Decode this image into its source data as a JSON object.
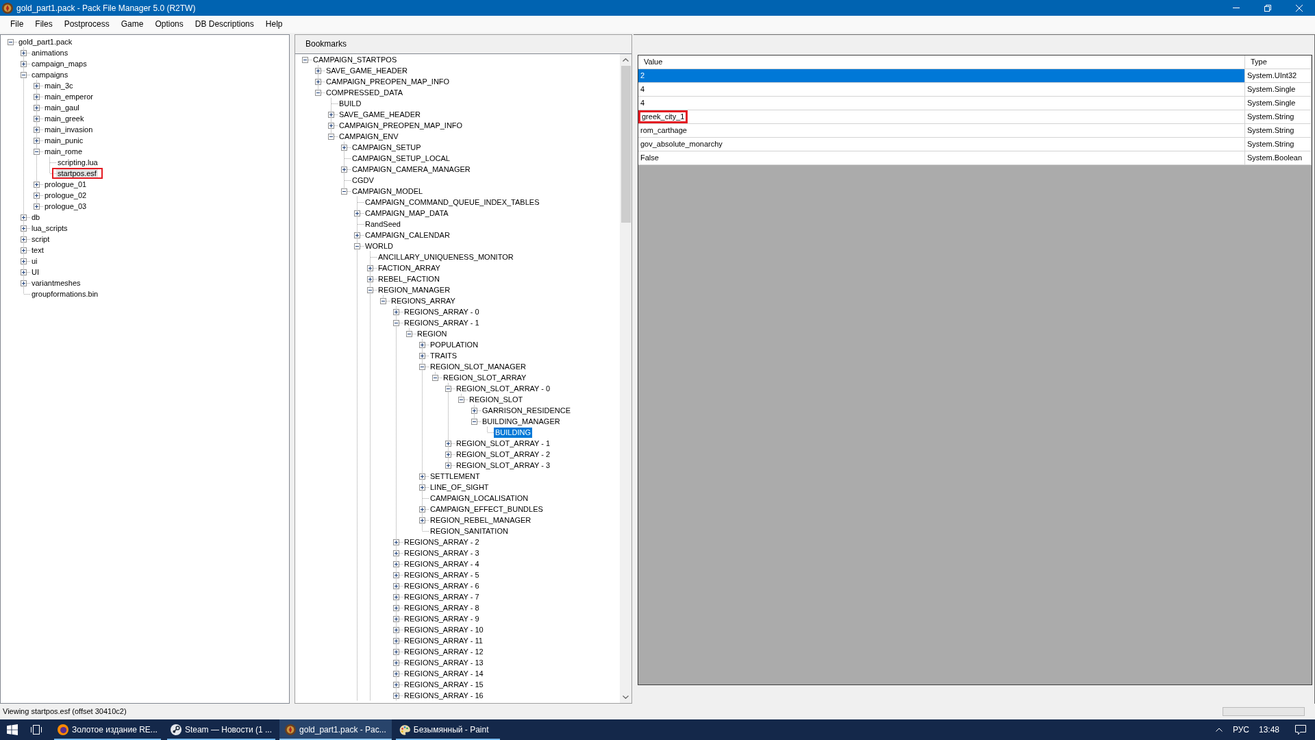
{
  "window": {
    "title": "gold_part1.pack - Pack File Manager 5.0 (R2TW)"
  },
  "menu": [
    "File",
    "Files",
    "Postprocess",
    "Game",
    "Options",
    "DB Descriptions",
    "Help"
  ],
  "file_tree": {
    "focused": false,
    "nodes": [
      {
        "label": "gold_part1.pack",
        "expanded": true,
        "selected": false,
        "annotated": false,
        "children": [
          {
            "label": "animations",
            "expanded": false,
            "selected": false,
            "annotated": false
          },
          {
            "label": "campaign_maps",
            "expanded": false,
            "selected": false,
            "annotated": false
          },
          {
            "label": "campaigns",
            "expanded": true,
            "selected": false,
            "annotated": false,
            "children": [
              {
                "label": "main_3c",
                "expanded": false,
                "selected": false,
                "annotated": false
              },
              {
                "label": "main_emperor",
                "expanded": false,
                "selected": false,
                "annotated": false
              },
              {
                "label": "main_gaul",
                "expanded": false,
                "selected": false,
                "annotated": false
              },
              {
                "label": "main_greek",
                "expanded": false,
                "selected": false,
                "annotated": false
              },
              {
                "label": "main_invasion",
                "expanded": false,
                "selected": false,
                "annotated": false
              },
              {
                "label": "main_punic",
                "expanded": false,
                "selected": false,
                "annotated": false
              },
              {
                "label": "main_rome",
                "expanded": true,
                "selected": false,
                "annotated": false,
                "children": [
                  {
                    "label": "scripting.lua",
                    "selected": false,
                    "annotated": false
                  },
                  {
                    "label": "startpos.esf",
                    "selected": true,
                    "annotated": true
                  }
                ]
              },
              {
                "label": "prologue_01",
                "expanded": false,
                "selected": false,
                "annotated": false
              },
              {
                "label": "prologue_02",
                "expanded": false,
                "selected": false,
                "annotated": false
              },
              {
                "label": "prologue_03",
                "expanded": false,
                "selected": false,
                "annotated": false
              }
            ]
          },
          {
            "label": "db",
            "expanded": false,
            "selected": false,
            "annotated": false
          },
          {
            "label": "lua_scripts",
            "expanded": false,
            "selected": false,
            "annotated": false
          },
          {
            "label": "script",
            "expanded": false,
            "selected": false,
            "annotated": false
          },
          {
            "label": "text",
            "expanded": false,
            "selected": false,
            "annotated": false
          },
          {
            "label": "ui",
            "expanded": false,
            "selected": false,
            "annotated": false
          },
          {
            "label": "UI",
            "expanded": false,
            "selected": false,
            "annotated": false
          },
          {
            "label": "variantmeshes",
            "expanded": false,
            "selected": false,
            "annotated": false
          },
          {
            "label": "groupformations.bin",
            "selected": false,
            "annotated": false
          }
        ]
      }
    ]
  },
  "esf_panel": {
    "toolbar_button": "Bookmarks",
    "tree": {
      "focused": true,
      "nodes": [
        {
          "label": "CAMPAIGN_STARTPOS",
          "expanded": true,
          "selected": false,
          "children": [
            {
              "label": "SAVE_GAME_HEADER",
              "expanded": false,
              "selected": false
            },
            {
              "label": "CAMPAIGN_PREOPEN_MAP_INFO",
              "expanded": false,
              "selected": false
            },
            {
              "label": "COMPRESSED_DATA",
              "expanded": true,
              "selected": false,
              "children": [
                {
                  "label": "BUILD",
                  "selected": false
                },
                {
                  "label": "SAVE_GAME_HEADER",
                  "expanded": false,
                  "selected": false
                },
                {
                  "label": "CAMPAIGN_PREOPEN_MAP_INFO",
                  "expanded": false,
                  "selected": false
                },
                {
                  "label": "CAMPAIGN_ENV",
                  "expanded": true,
                  "selected": false,
                  "children": [
                    {
                      "label": "CAMPAIGN_SETUP",
                      "expanded": false,
                      "selected": false
                    },
                    {
                      "label": "CAMPAIGN_SETUP_LOCAL",
                      "selected": false
                    },
                    {
                      "label": "CAMPAIGN_CAMERA_MANAGER",
                      "expanded": false,
                      "selected": false
                    },
                    {
                      "label": "CGDV",
                      "selected": false
                    },
                    {
                      "label": "CAMPAIGN_MODEL",
                      "expanded": true,
                      "selected": false,
                      "more_below": true,
                      "children": [
                        {
                          "label": "CAMPAIGN_COMMAND_QUEUE_INDEX_TABLES",
                          "selected": false
                        },
                        {
                          "label": "CAMPAIGN_MAP_DATA",
                          "expanded": false,
                          "selected": false
                        },
                        {
                          "label": "RandSeed",
                          "selected": false
                        },
                        {
                          "label": "CAMPAIGN_CALENDAR",
                          "expanded": false,
                          "selected": false
                        },
                        {
                          "label": "WORLD",
                          "expanded": true,
                          "selected": false,
                          "more_below": true,
                          "children": [
                            {
                              "label": "ANCILLARY_UNIQUENESS_MONITOR",
                              "selected": false
                            },
                            {
                              "label": "FACTION_ARRAY",
                              "expanded": false,
                              "selected": false
                            },
                            {
                              "label": "REBEL_FACTION",
                              "expanded": false,
                              "selected": false
                            },
                            {
                              "label": "REGION_MANAGER",
                              "expanded": true,
                              "selected": false,
                              "children": [
                                {
                                  "label": "REGIONS_ARRAY",
                                  "expanded": true,
                                  "selected": false,
                                  "more_below": true,
                                  "children": [
                                    {
                                      "label": "REGIONS_ARRAY - 0",
                                      "expanded": false,
                                      "selected": false
                                    },
                                    {
                                      "label": "REGIONS_ARRAY - 1",
                                      "expanded": true,
                                      "selected": false,
                                      "children": [
                                        {
                                          "label": "REGION",
                                          "expanded": true,
                                          "selected": false,
                                          "children": [
                                            {
                                              "label": "POPULATION",
                                              "expanded": false,
                                              "selected": false
                                            },
                                            {
                                              "label": "TRAITS",
                                              "expanded": false,
                                              "selected": false
                                            },
                                            {
                                              "label": "REGION_SLOT_MANAGER",
                                              "expanded": true,
                                              "selected": false,
                                              "children": [
                                                {
                                                  "label": "REGION_SLOT_ARRAY",
                                                  "expanded": true,
                                                  "selected": false,
                                                  "children": [
                                                    {
                                                      "label": "REGION_SLOT_ARRAY - 0",
                                                      "expanded": true,
                                                      "selected": false,
                                                      "children": [
                                                        {
                                                          "label": "REGION_SLOT",
                                                          "expanded": true,
                                                          "selected": false,
                                                          "children": [
                                                            {
                                                              "label": "GARRISON_RESIDENCE",
                                                              "expanded": false,
                                                              "selected": false
                                                            },
                                                            {
                                                              "label": "BUILDING_MANAGER",
                                                              "expanded": true,
                                                              "selected": false,
                                                              "children": [
                                                                {
                                                                  "label": "BUILDING",
                                                                  "selected": true
                                                                }
                                                              ]
                                                            }
                                                          ]
                                                        }
                                                      ]
                                                    },
                                                    {
                                                      "label": "REGION_SLOT_ARRAY - 1",
                                                      "expanded": false,
                                                      "selected": false
                                                    },
                                                    {
                                                      "label": "REGION_SLOT_ARRAY - 2",
                                                      "expanded": false,
                                                      "selected": false
                                                    },
                                                    {
                                                      "label": "REGION_SLOT_ARRAY - 3",
                                                      "expanded": false,
                                                      "selected": false
                                                    }
                                                  ]
                                                }
                                              ]
                                            },
                                            {
                                              "label": "SETTLEMENT",
                                              "expanded": false,
                                              "selected": false
                                            },
                                            {
                                              "label": "LINE_OF_SIGHT",
                                              "expanded": false,
                                              "selected": false
                                            },
                                            {
                                              "label": "CAMPAIGN_LOCALISATION",
                                              "selected": false
                                            },
                                            {
                                              "label": "CAMPAIGN_EFFECT_BUNDLES",
                                              "expanded": false,
                                              "selected": false
                                            },
                                            {
                                              "label": "REGION_REBEL_MANAGER",
                                              "expanded": false,
                                              "selected": false
                                            },
                                            {
                                              "label": "REGION_SANITATION",
                                              "selected": false
                                            }
                                          ]
                                        }
                                      ]
                                    },
                                    {
                                      "label": "REGIONS_ARRAY - 2",
                                      "expanded": false,
                                      "selected": false
                                    },
                                    {
                                      "label": "REGIONS_ARRAY - 3",
                                      "expanded": false,
                                      "selected": false
                                    },
                                    {
                                      "label": "REGIONS_ARRAY - 4",
                                      "expanded": false,
                                      "selected": false
                                    },
                                    {
                                      "label": "REGIONS_ARRAY - 5",
                                      "expanded": false,
                                      "selected": false
                                    },
                                    {
                                      "label": "REGIONS_ARRAY - 6",
                                      "expanded": false,
                                      "selected": false
                                    },
                                    {
                                      "label": "REGIONS_ARRAY - 7",
                                      "expanded": false,
                                      "selected": false
                                    },
                                    {
                                      "label": "REGIONS_ARRAY - 8",
                                      "expanded": false,
                                      "selected": false
                                    },
                                    {
                                      "label": "REGIONS_ARRAY - 9",
                                      "expanded": false,
                                      "selected": false
                                    },
                                    {
                                      "label": "REGIONS_ARRAY - 10",
                                      "expanded": false,
                                      "selected": false
                                    },
                                    {
                                      "label": "REGIONS_ARRAY - 11",
                                      "expanded": false,
                                      "selected": false
                                    },
                                    {
                                      "label": "REGIONS_ARRAY - 12",
                                      "expanded": false,
                                      "selected": false
                                    },
                                    {
                                      "label": "REGIONS_ARRAY - 13",
                                      "expanded": false,
                                      "selected": false
                                    },
                                    {
                                      "label": "REGIONS_ARRAY - 14",
                                      "expanded": false,
                                      "selected": false
                                    },
                                    {
                                      "label": "REGIONS_ARRAY - 15",
                                      "expanded": false,
                                      "selected": false
                                    },
                                    {
                                      "label": "REGIONS_ARRAY - 16",
                                      "expanded": false,
                                      "selected": false
                                    }
                                  ]
                                }
                              ]
                            }
                          ]
                        }
                      ]
                    }
                  ]
                }
              ]
            }
          ]
        }
      ]
    }
  },
  "value_grid": {
    "columns": [
      "Value",
      "Type"
    ],
    "rows": [
      {
        "value": "2",
        "type": "System.UInt32",
        "selected": true,
        "annotated": false
      },
      {
        "value": "4",
        "type": "System.Single",
        "selected": false,
        "annotated": false
      },
      {
        "value": "4",
        "type": "System.Single",
        "selected": false,
        "annotated": false
      },
      {
        "value": "greek_city_1",
        "type": "System.String",
        "selected": false,
        "annotated": true
      },
      {
        "value": "rom_carthage",
        "type": "System.String",
        "selected": false,
        "annotated": false
      },
      {
        "value": "gov_absolute_monarchy",
        "type": "System.String",
        "selected": false,
        "annotated": false
      },
      {
        "value": "False",
        "type": "System.Boolean",
        "selected": false,
        "annotated": false
      }
    ]
  },
  "status_bar": {
    "text": "Viewing startpos.esf (offset 30410c2)",
    "progress": {
      "level": 0
    }
  },
  "taskbar": {
    "apps": [
      {
        "label": "Золотое издание RE...",
        "kind": "browser",
        "selected": false
      },
      {
        "label": "Steam — Новости (1 ...",
        "kind": "steam",
        "selected": false
      },
      {
        "label": "gold_part1.pack - Pac...",
        "kind": "pack",
        "selected": true
      },
      {
        "label": "Безымянный - Paint",
        "kind": "paint",
        "selected": false
      }
    ],
    "tray": {
      "language": "РУС",
      "time": "13:48"
    }
  }
}
